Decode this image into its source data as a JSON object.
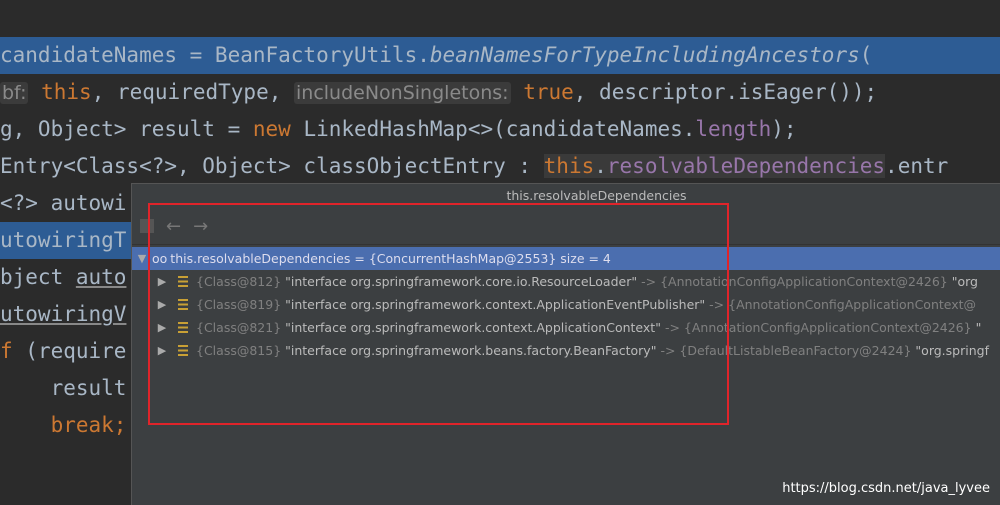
{
  "code_lines": [
    {
      "parts": [
        "candidateNames = BeanFactoryUtils.",
        "beanNamesForTypeIncludingAncestors",
        "("
      ]
    },
    {
      "parts": [
        "bf:",
        " this",
        ", requiredType, ",
        "includeNonSingletons:",
        " true",
        ", descriptor.isEager());"
      ]
    },
    {
      "parts": [
        "g, Object> result = ",
        "new",
        " LinkedHashMap<>(candidateNames.",
        "length",
        ");"
      ]
    },
    {
      "parts": [
        "Entry<Class<?>, Object> classObjectEntry : ",
        "this",
        ".",
        "resolvableDependencies",
        ".entr"
      ]
    },
    {
      "parts": [
        "<?> autowi"
      ]
    },
    {
      "parts": [
        "utowiringT"
      ]
    },
    {
      "parts": [
        "bject ",
        "auto"
      ]
    },
    {
      "parts": [
        "utowiringV"
      ]
    },
    {
      "parts": [
        "f",
        " (require"
      ]
    },
    {
      "parts": [
        "    result."
      ]
    },
    {
      "parts": [
        "    ",
        "break;"
      ]
    }
  ],
  "popup": {
    "title": "this.resolvableDependencies",
    "toolbar": {
      "icon": "restore-icon",
      "back": "←",
      "forward": "→"
    },
    "root": {
      "name": "this.resolvableDependencies",
      "value": "= {ConcurrentHashMap@2553}  size = 4"
    },
    "entries": [
      {
        "cls": "{Class@812}",
        "key": "\"interface org.springframework.core.io.ResourceLoader\"",
        "arrow": "->",
        "val": "{AnnotationConfigApplicationContext@2426}",
        "str": "\"org"
      },
      {
        "cls": "{Class@819}",
        "key": "\"interface org.springframework.context.ApplicationEventPublisher\"",
        "arrow": "->",
        "val": "{AnnotationConfigApplicationContext@",
        "str": ""
      },
      {
        "cls": "{Class@821}",
        "key": "\"interface org.springframework.context.ApplicationContext\"",
        "arrow": "->",
        "val": "{AnnotationConfigApplicationContext@2426}",
        "str": "\""
      },
      {
        "cls": "{Class@815}",
        "key": "\"interface org.springframework.beans.factory.BeanFactory\"",
        "arrow": "->",
        "val": "{DefaultListableBeanFactory@2424}",
        "str": "\"org.springf"
      }
    ]
  },
  "watermark": "https://blog.csdn.net/java_lyvee",
  "colors": {
    "selection": "#2d5c94",
    "tree_selection": "#4b6eaf",
    "annotation_box": "#e0242a",
    "keyword": "#cc7832",
    "field": "#9876aa"
  }
}
